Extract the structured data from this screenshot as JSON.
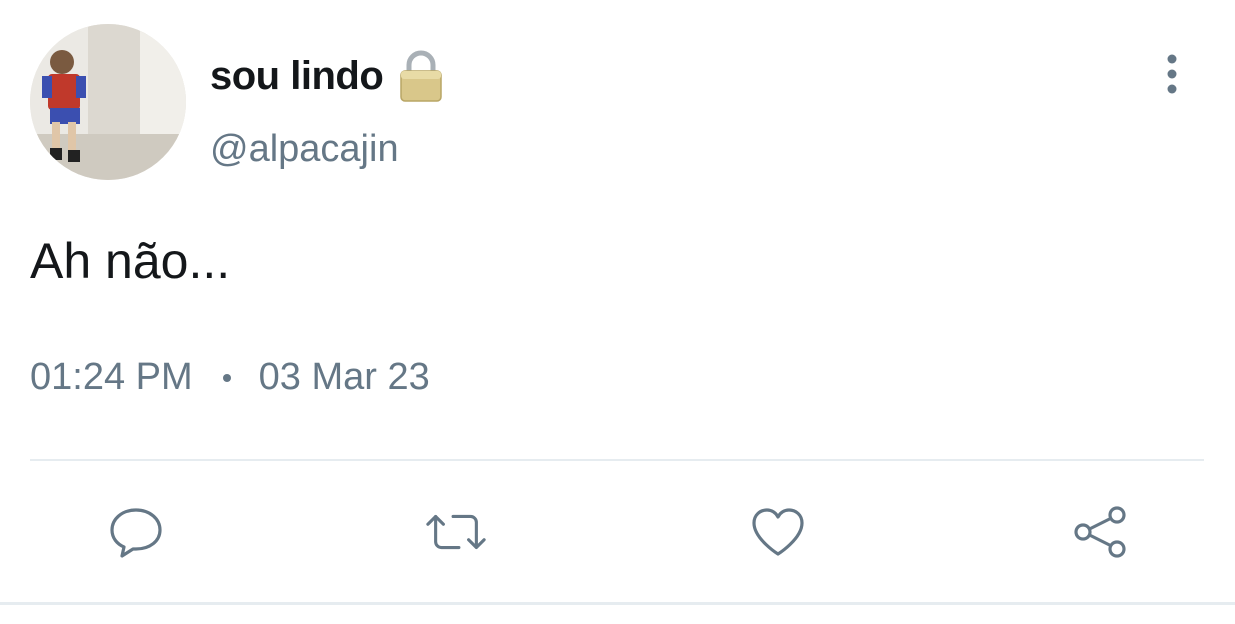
{
  "user": {
    "display_name": "sou lindo",
    "handle": "@alpacajin",
    "protected_icon": "lock-icon",
    "avatar_icon": "avatar-photo"
  },
  "tweet": {
    "text": "Ah não...",
    "time": "01:24 PM",
    "date": "03 Mar 23"
  },
  "actions": {
    "reply_icon": "reply-icon",
    "retweet_icon": "retweet-icon",
    "like_icon": "heart-icon",
    "share_icon": "share-icon",
    "more_icon": "more-vertical-icon"
  },
  "colors": {
    "text_primary": "#14171a",
    "text_secondary": "#657786",
    "icon": "#657786",
    "divider": "#e6ecf0",
    "lock_gold": "#d9c78a"
  }
}
